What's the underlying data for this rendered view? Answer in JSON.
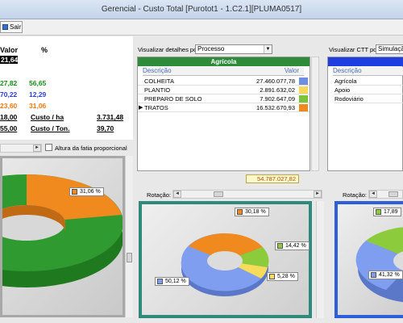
{
  "window": {
    "title": "Gerencial - Custo Total   [Purotot1 - 1.C2.1][PLUMA0517]"
  },
  "toolbar": {
    "sair_label": "Sair"
  },
  "summary": {
    "header_valor": "Valor",
    "header_pct": "%",
    "highlight_value": "21,64",
    "values": [
      {
        "valor": "27,82",
        "pct": "56,65",
        "color": "#1a8a1a"
      },
      {
        "valor": "70,22",
        "pct": "12,29",
        "color": "#2a3fd6"
      },
      {
        "valor": "23,60",
        "pct": "31,06",
        "color": "#f07a10"
      },
      {
        "valor": "18,00",
        "pct": "",
        "color": "#000000"
      },
      {
        "valor": "55,00",
        "pct": "",
        "color": "#000000"
      }
    ],
    "custo_ha_label": "Custo / ha",
    "custo_ha_value": "3.731,48",
    "custo_ton_label": "Custo / Ton.",
    "custo_ton_value": "39,70"
  },
  "left_chart": {
    "checkbox_label": "Altura da fatia proporcional",
    "slice_label": "31,06 %",
    "colors": {
      "orange": "#f08a1e",
      "green": "#2f9a2f",
      "frame": "#9a9a9a"
    }
  },
  "details": {
    "label": "Visualizar detalhes por",
    "select_value": "Processo",
    "grid_title": "Agrícola",
    "col_descricao": "Descrição",
    "col_valor": "Valor",
    "rows": [
      {
        "descricao": "COLHEITA",
        "valor": "27.460.077,78",
        "color": "#6f8fe0"
      },
      {
        "descricao": "PLANTIO",
        "valor": "2.891.632,02",
        "color": "#f6d85a"
      },
      {
        "descricao": "PREPARO DE SOLO",
        "valor": "7.902.647,09",
        "color": "#7cc33c"
      },
      {
        "descricao": "TRATOS",
        "valor": "16.532.670,93",
        "color": "#f08a1e"
      }
    ],
    "total": "54.787.027,82"
  },
  "ctt": {
    "label": "Visualizar CTT por",
    "select_value": "Simulação",
    "col_descricao": "Descrição",
    "rows": [
      "Agrícola",
      "Apoio",
      "Rodoviário"
    ]
  },
  "middle_chart": {
    "rotacao_label": "Rotação:",
    "labels": {
      "orange": "30,18 %",
      "green": "14,42 %",
      "yellow": "5,28 %",
      "blue": "50,12 %"
    },
    "colors": {
      "blue": "#7f9ef0",
      "orange": "#f08a1e",
      "green": "#8ccb3c",
      "yellow": "#f6dc5a",
      "frame": "#2e8a7a"
    }
  },
  "right_chart": {
    "rotacao_label": "Rotação:",
    "labels": {
      "green": "17,89",
      "blue": "41,32 %"
    },
    "colors": {
      "frame": "#2f5fd8"
    }
  }
}
